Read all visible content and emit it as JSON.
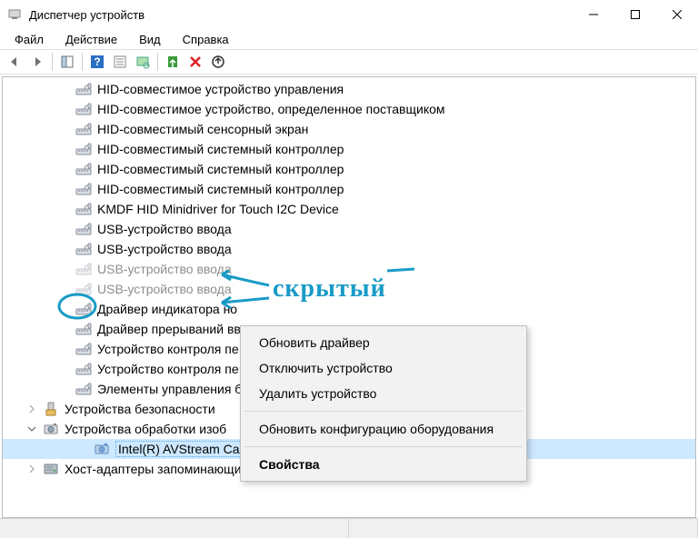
{
  "title": "Диспетчер устройств",
  "menu": {
    "file": "Файл",
    "action": "Действие",
    "view": "Вид",
    "help": "Справка"
  },
  "annotation": "скрытый",
  "devices": [
    {
      "label": "HID-совместимое устройство управления",
      "type": "hid"
    },
    {
      "label": "HID-совместимое устройство, определенное поставщиком",
      "type": "hid"
    },
    {
      "label": "HID-совместимый сенсорный экран",
      "type": "hid"
    },
    {
      "label": "HID-совместимый системный контроллер",
      "type": "hid"
    },
    {
      "label": "HID-совместимый системный контроллер",
      "type": "hid"
    },
    {
      "label": "HID-совместимый системный контроллер",
      "type": "hid"
    },
    {
      "label": "KMDF HID Minidriver for Touch I2C Device",
      "type": "hid"
    },
    {
      "label": "USB-устройство ввода",
      "type": "hid"
    },
    {
      "label": "USB-устройство ввода",
      "type": "hid"
    },
    {
      "label": "USB-устройство ввода",
      "type": "hid",
      "faded": true
    },
    {
      "label": "USB-устройство ввода",
      "type": "hid",
      "faded": true,
      "circled": true
    },
    {
      "label": "Драйвер индикатора но",
      "type": "hid"
    },
    {
      "label": "Драйвер прерываний вв",
      "type": "hid"
    },
    {
      "label": "Устройство контроля пе",
      "type": "hid"
    },
    {
      "label": "Устройство контроля пе",
      "type": "hid"
    },
    {
      "label": "Элементы управления б",
      "type": "hid"
    }
  ],
  "categories": [
    {
      "label": "Устройства безопасности",
      "type": "security",
      "expand": ">"
    },
    {
      "label": "Устройства обработки изоб",
      "type": "imaging",
      "expand": "v"
    }
  ],
  "selected_device": "Intel(R) AVStream Camera",
  "last_category": "Хост-адаптеры запоминающих устройств",
  "context_menu": {
    "update": "Обновить драйвер",
    "disable": "Отключить устройство",
    "uninstall": "Удалить устройство",
    "scan": "Обновить конфигурацию оборудования",
    "properties": "Свойства"
  }
}
